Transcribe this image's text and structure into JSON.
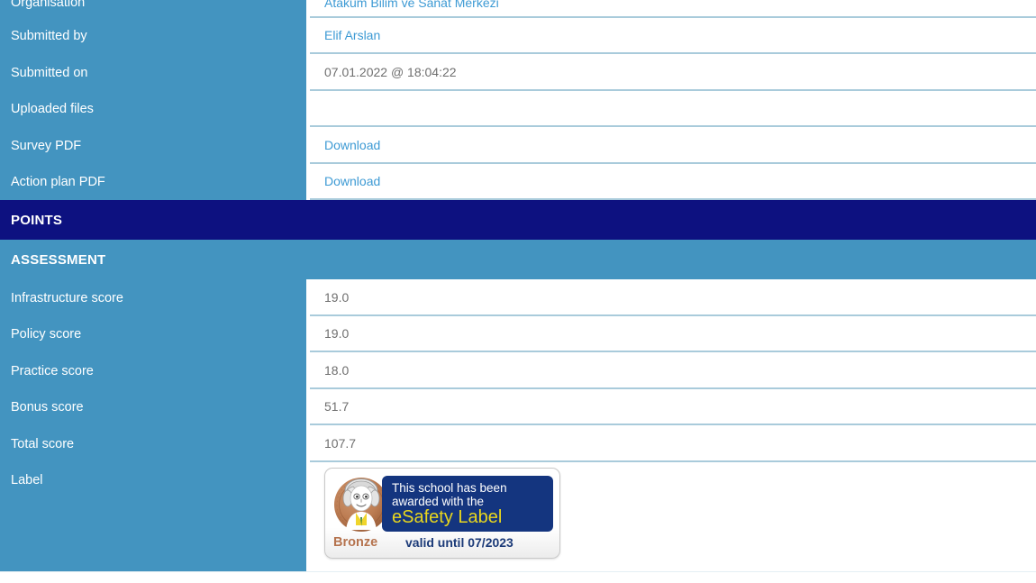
{
  "theme": {
    "label_column_bg": "#4394c0",
    "points_bar_bg": "#0d1180",
    "assessment_bar_bg": "#4394c0",
    "value_bg": "#ffffff",
    "separator": "#a9cbdb",
    "link_color": "#3d9ad4",
    "value_text_color": "#6f6f6f"
  },
  "rows": [
    {
      "label": "Organisation",
      "value": "Atakum Bilim ve Sanat Merkezi",
      "kind": "link"
    },
    {
      "label": "Submitted by",
      "value": "Elif Arslan",
      "kind": "link"
    },
    {
      "label": "Submitted on",
      "value": "07.01.2022 @ 18:04:22",
      "kind": "text"
    },
    {
      "label": "Uploaded files",
      "value": "",
      "kind": "text"
    },
    {
      "label": "Survey PDF",
      "value": "Download",
      "kind": "link"
    },
    {
      "label": "Action plan PDF",
      "value": "Download",
      "kind": "link"
    }
  ],
  "sections": {
    "points": "POINTS",
    "assessment": "ASSESSMENT"
  },
  "scores": [
    {
      "label": "Infrastructure score",
      "value": "19.0"
    },
    {
      "label": "Policy score",
      "value": "19.0"
    },
    {
      "label": "Practice score",
      "value": "18.0"
    },
    {
      "label": "Bonus score",
      "value": "51.7"
    },
    {
      "label": "Total score",
      "value": "107.7"
    }
  ],
  "label_row": {
    "label": "Label",
    "badge": {
      "line1": "This school has been",
      "line2": "awarded with the",
      "line3": "eSafety Label",
      "tier": "Bronze",
      "validity": "valid until 07/2023",
      "navy": "#14357f",
      "accent_yellow": "#e9d71d",
      "bronze_color": "#b5734e"
    }
  }
}
